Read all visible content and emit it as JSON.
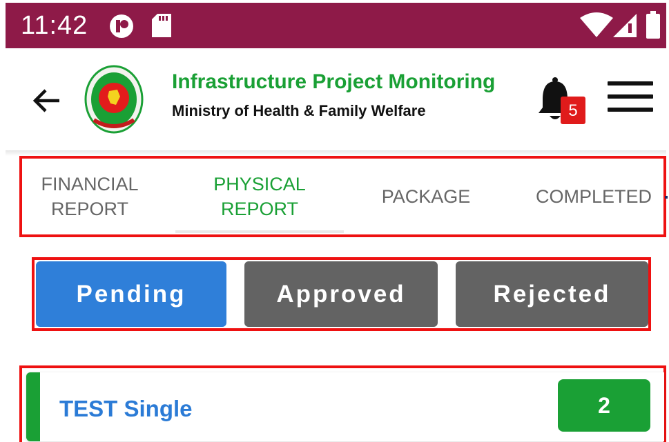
{
  "status_bar": {
    "time": "11:42",
    "background": "#8e1a48",
    "icons": [
      "notification-app-icon",
      "sd-card-icon",
      "wifi-icon",
      "cell-signal-icon",
      "battery-icon"
    ]
  },
  "app_bar": {
    "title": "Infrastructure Project Monitoring",
    "subtitle": "Ministry of Health & Family Welfare",
    "notification_count": "5",
    "title_color": "#1aa035"
  },
  "tabs": [
    {
      "label": "FINANCIAL REPORT",
      "active": false
    },
    {
      "label": "PHYSICAL REPORT",
      "active": true
    },
    {
      "label": "PACKAGE",
      "active": false
    },
    {
      "label": "COMPLETED",
      "active": false
    }
  ],
  "segments": [
    {
      "label": "Pending",
      "color": "#2f7fd9",
      "active": true
    },
    {
      "label": "Approved",
      "color": "#636363",
      "active": false
    },
    {
      "label": "Rejected",
      "color": "#636363",
      "active": false
    }
  ],
  "list": [
    {
      "title": "TEST Single",
      "count": "2"
    }
  ]
}
